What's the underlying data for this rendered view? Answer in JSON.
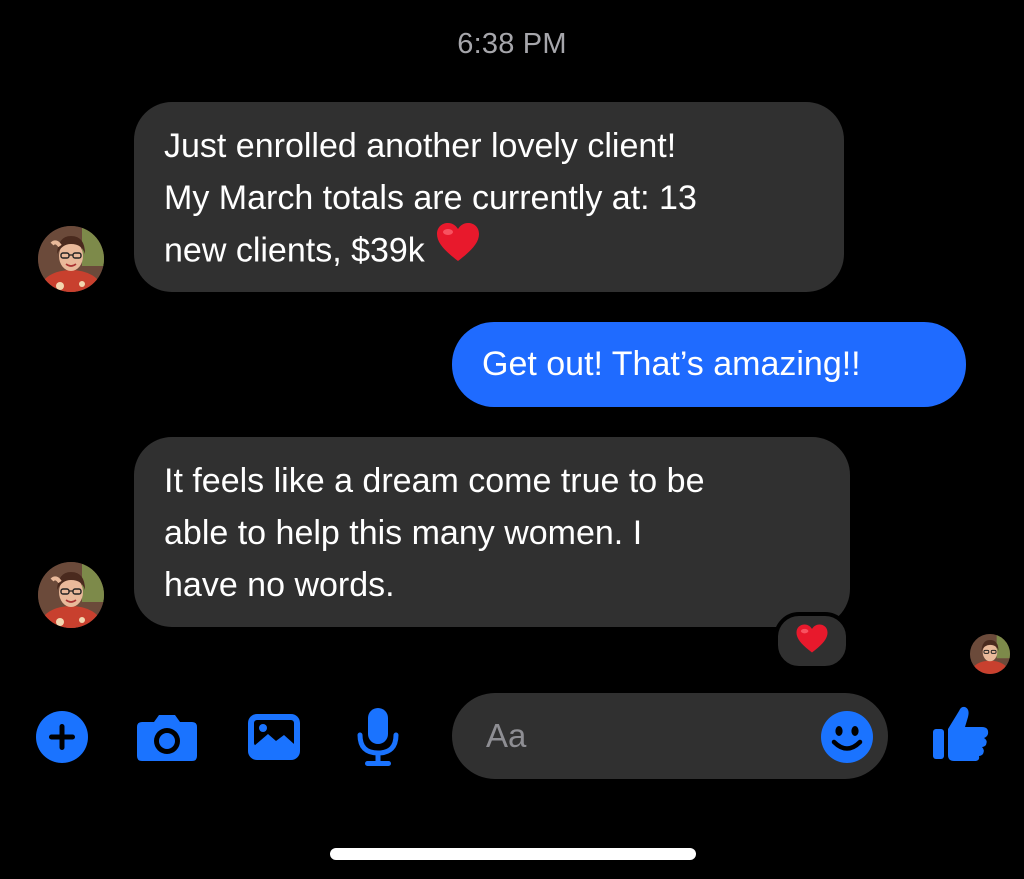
{
  "thread": {
    "timestamp": "6:38 PM"
  },
  "messages": [
    {
      "direction": "incoming",
      "lines": [
        "Just enrolled another lovely client!",
        "My March totals are currently at: 13",
        "new clients, $39k"
      ],
      "trailing_emoji": "red-heart"
    },
    {
      "direction": "outgoing",
      "text": "Get out! That’s amazing!!"
    },
    {
      "direction": "incoming",
      "lines": [
        "It feels like a dream come true to be",
        "able to help this many women. I",
        "have no words."
      ],
      "reaction": "red-heart"
    }
  ],
  "composer": {
    "placeholder": "Aa",
    "icons": [
      "plus-circle-icon",
      "camera-icon",
      "photo-icon",
      "microphone-icon",
      "smiley-icon",
      "thumbs-up-icon"
    ]
  },
  "colors": {
    "background": "#000000",
    "incoming_bubble": "#303030",
    "outgoing_bubble": "#1f6bff",
    "accent_icon": "#1a73ff",
    "timestamp_text": "#a6a6ab",
    "heart": "#e8192c"
  }
}
